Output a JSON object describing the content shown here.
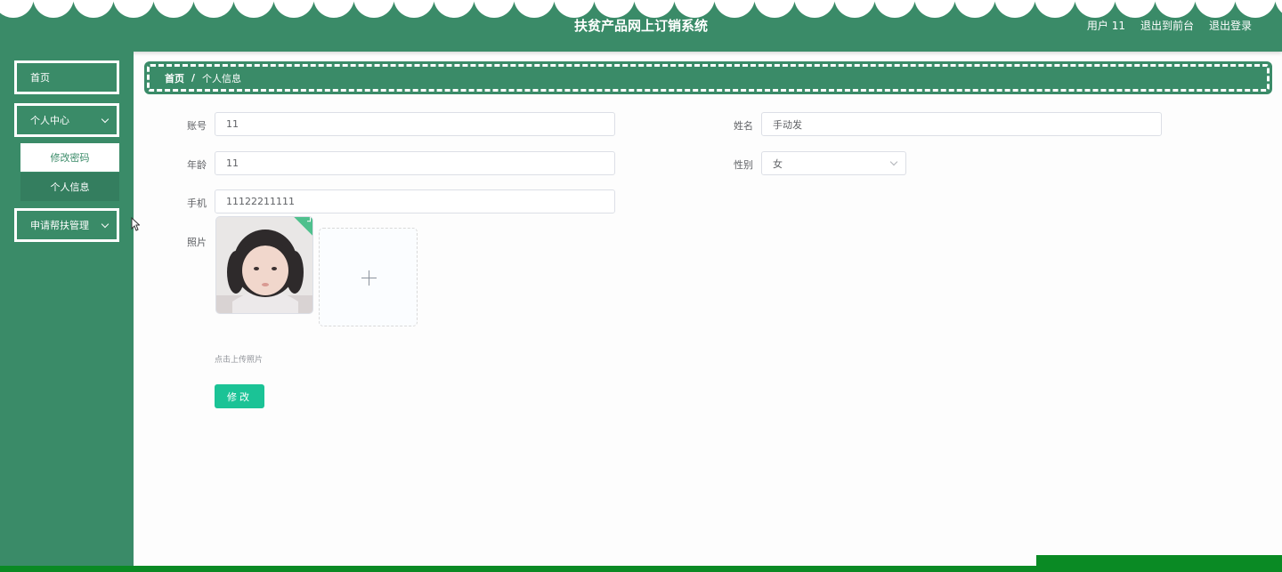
{
  "header": {
    "title": "扶贫产品网上订销系统",
    "links": [
      "用户 11",
      "退出到前台",
      "退出登录"
    ]
  },
  "sidebar": {
    "items": [
      {
        "label": "首页"
      },
      {
        "label": "个人中心",
        "submenu": [
          "修改密码",
          "个人信息"
        ]
      },
      {
        "label": "申请帮扶管理"
      }
    ]
  },
  "breadcrumb": {
    "home": "首页",
    "separator": "/",
    "current": "个人信息"
  },
  "form": {
    "account_label": "账号",
    "account_value": "11",
    "name_label": "姓名",
    "name_value": "手动发",
    "age_label": "年龄",
    "age_value": "11",
    "gender_label": "性别",
    "gender_value": "女",
    "phone_label": "手机",
    "phone_value": "11122211111",
    "photo_label": "照片",
    "upload_hint": "点击上传照片",
    "submit_label": "修改"
  },
  "colors": {
    "primary": "#3a8b68",
    "submit": "#1bc396",
    "bottom_bar": "#0a8a24"
  },
  "icons": [
    "chevron-down-icon",
    "plus-icon",
    "check-icon",
    "cursor-icon"
  ]
}
